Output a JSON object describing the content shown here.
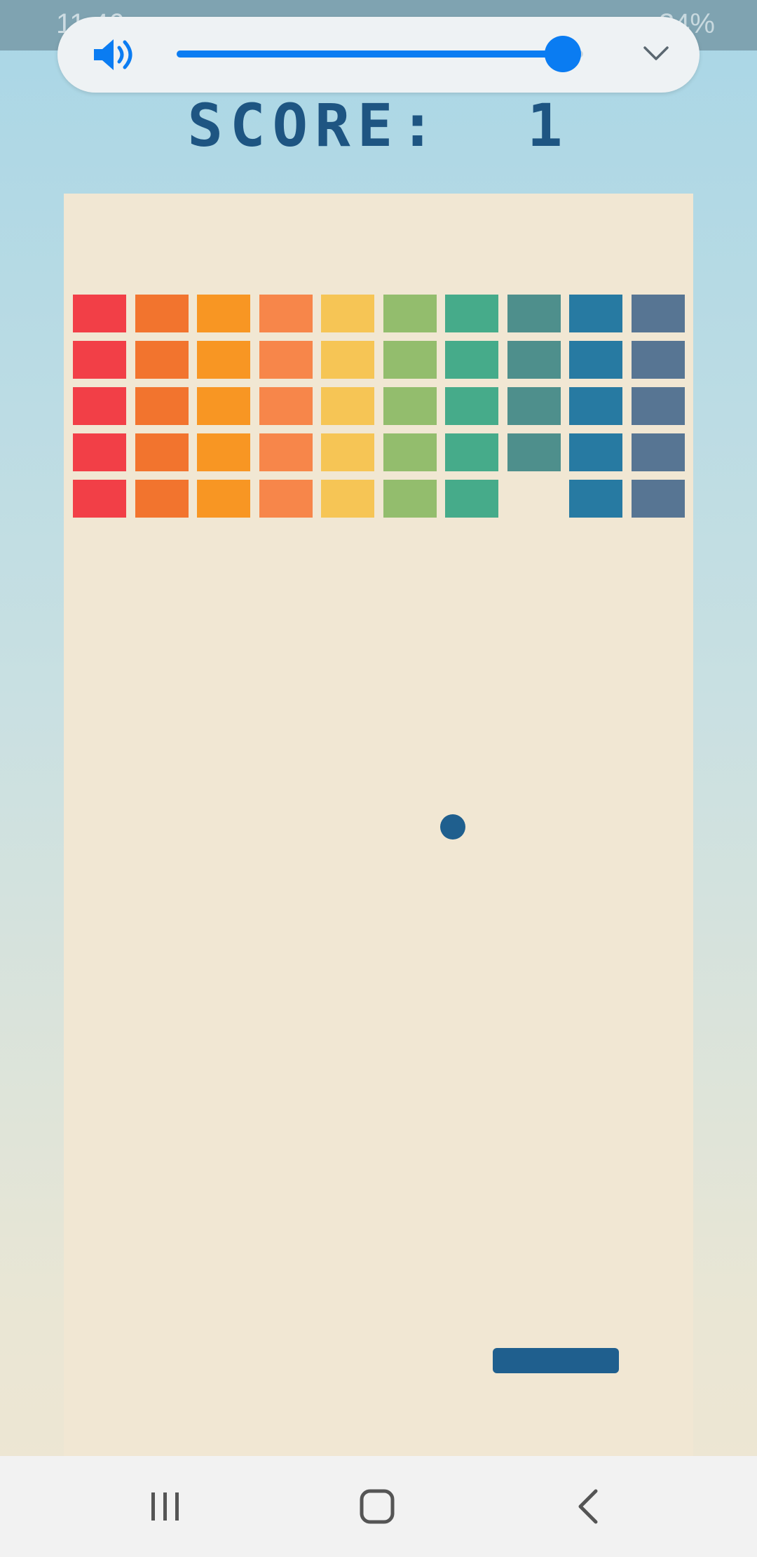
{
  "status_bar": {
    "time": "11:46",
    "battery": "34%",
    "icons": [
      "image-icon",
      "telegram-icon",
      "gmail-icon",
      "dot-icon",
      "bluetooth-icon",
      "wifi-icon",
      "signal-icon",
      "battery-icon"
    ]
  },
  "volume": {
    "level_percent": 95,
    "accent_color": "#0a7cf2",
    "icons": [
      "speaker-icon",
      "chevron-down-icon"
    ]
  },
  "score": {
    "label": "SCORE:",
    "value": "1"
  },
  "game": {
    "column_colors": [
      "#f23f47",
      "#f2742e",
      "#f89623",
      "#f7864a",
      "#f6c555",
      "#93bd6d",
      "#46ab8a",
      "#4e8f8c",
      "#277aa2",
      "#577593"
    ],
    "rows": 5,
    "missing_bricks": [
      [
        4,
        7
      ]
    ],
    "ball_color": "#1f5f8e",
    "paddle_color": "#1f5f8e"
  },
  "nav": {
    "buttons": [
      "recent-apps-icon",
      "home-icon",
      "back-icon"
    ]
  }
}
